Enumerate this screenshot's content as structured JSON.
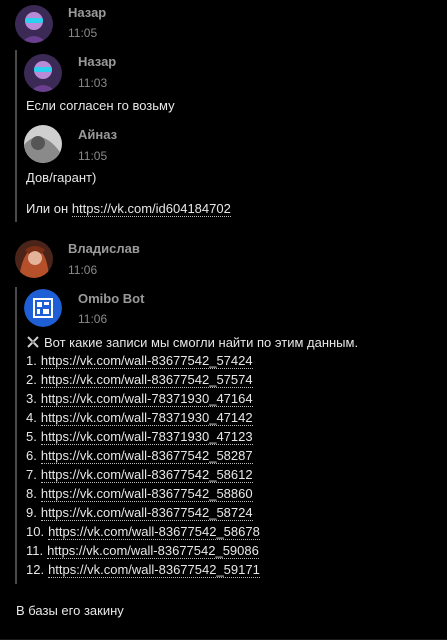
{
  "messages": {
    "m1": {
      "author": "Назар",
      "time": "11:05"
    },
    "quote1": {
      "author": "Назар",
      "time": "11:03",
      "text": "Если согласен го возьму"
    },
    "quote2": {
      "author": "Айназ",
      "time": "11:05",
      "line1": "Дов/гарант)",
      "line2_prefix": "Или он ",
      "line2_link": "https://vk.com/id604184702"
    },
    "m2": {
      "author": "Владислав",
      "time": "11:06"
    },
    "bot": {
      "author": "Omibo Bot",
      "time": "11:06",
      "intro_icon": "crossed-swords-icon",
      "intro": "Вот какие записи мы смогли найти по этим данным.",
      "links": [
        {
          "num": "1.",
          "url": "https://vk.com/wall-83677542_57424"
        },
        {
          "num": "2.",
          "url": "https://vk.com/wall-83677542_57574"
        },
        {
          "num": "3.",
          "url": "https://vk.com/wall-78371930_47164"
        },
        {
          "num": "4.",
          "url": "https://vk.com/wall-78371930_47142"
        },
        {
          "num": "5.",
          "url": "https://vk.com/wall-78371930_47123"
        },
        {
          "num": "6.",
          "url": "https://vk.com/wall-83677542_58287"
        },
        {
          "num": "7.",
          "url": "https://vk.com/wall-83677542_58612"
        },
        {
          "num": "8.",
          "url": "https://vk.com/wall-83677542_58860"
        },
        {
          "num": "9.",
          "url": "https://vk.com/wall-83677542_58724"
        },
        {
          "num": "10.",
          "url": "https://vk.com/wall-83677542_58678"
        },
        {
          "num": "11.",
          "url": "https://vk.com/wall-83677542_59086"
        },
        {
          "num": "12.",
          "url": "https://vk.com/wall-83677542_59171"
        }
      ]
    },
    "reply": {
      "text": "В базы его закину"
    }
  },
  "colors": {
    "background": "#000000",
    "name": "#9a9a9a",
    "text": "#e8e8e8",
    "quote_bar": "#4a4a4a",
    "bot_avatar": "#1f5fd6"
  }
}
